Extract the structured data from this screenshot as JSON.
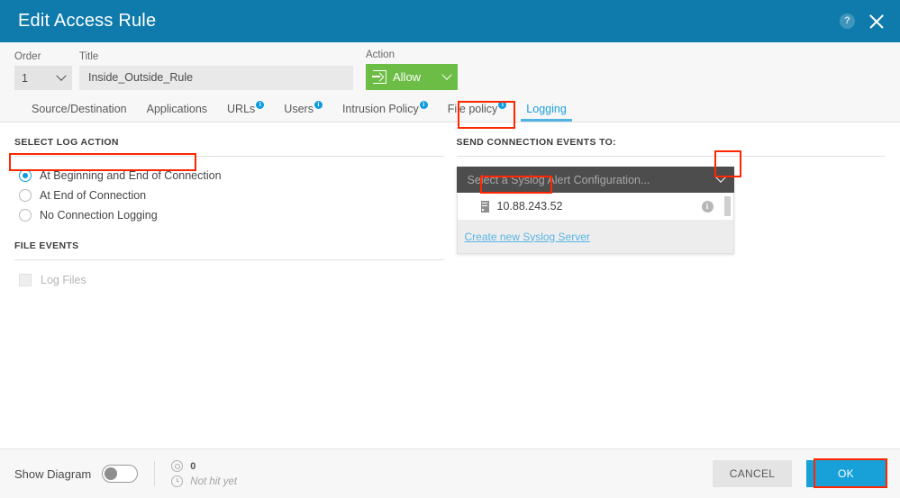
{
  "window": {
    "title": "Edit Access Rule",
    "help_icon": "help-icon",
    "close_icon": "close-icon"
  },
  "header_form": {
    "order_label": "Order",
    "order_value": "1",
    "title_label": "Title",
    "title_value": "Inside_Outside_Rule",
    "action_label": "Action",
    "action_value": "Allow",
    "action_color": "#6cbd45"
  },
  "tabs": [
    {
      "label": "Source/Destination",
      "info": false,
      "active": false
    },
    {
      "label": "Applications",
      "info": false,
      "active": false
    },
    {
      "label": "URLs",
      "info": true,
      "active": false
    },
    {
      "label": "Users",
      "info": true,
      "active": false
    },
    {
      "label": "Intrusion Policy",
      "info": true,
      "active": false
    },
    {
      "label": "File policy",
      "info": true,
      "active": false
    },
    {
      "label": "Logging",
      "info": false,
      "active": true
    }
  ],
  "left_panel": {
    "section_title": "SELECT LOG ACTION",
    "options": [
      {
        "label": "At Beginning and End of Connection",
        "selected": true
      },
      {
        "label": "At End of Connection",
        "selected": false
      },
      {
        "label": "No Connection Logging",
        "selected": false
      }
    ],
    "file_events_title": "FILE EVENTS",
    "log_files_label": "Log Files",
    "log_files_checked": false
  },
  "right_panel": {
    "section_title": "SEND CONNECTION EVENTS TO:",
    "dropdown_placeholder": "Select a Syslog Alert Configuration...",
    "options": [
      {
        "label": "10.88.243.52",
        "icon": "server-icon",
        "info": "i"
      }
    ],
    "create_link": "Create new Syslog Server"
  },
  "footer": {
    "show_diagram_label": "Show Diagram",
    "show_diagram_on": false,
    "hit_count": "0",
    "hit_status": "Not hit yet",
    "cancel_label": "CANCEL",
    "ok_label": "OK",
    "ok_color": "#18a0d8"
  },
  "annotations": {
    "color": "#ff2600",
    "boxes": [
      {
        "name": "logging-tab-highlight"
      },
      {
        "name": "log-action-option-highlight"
      },
      {
        "name": "dropdown-arrow-highlight"
      },
      {
        "name": "syslog-server-highlight"
      },
      {
        "name": "ok-button-highlight"
      }
    ]
  }
}
